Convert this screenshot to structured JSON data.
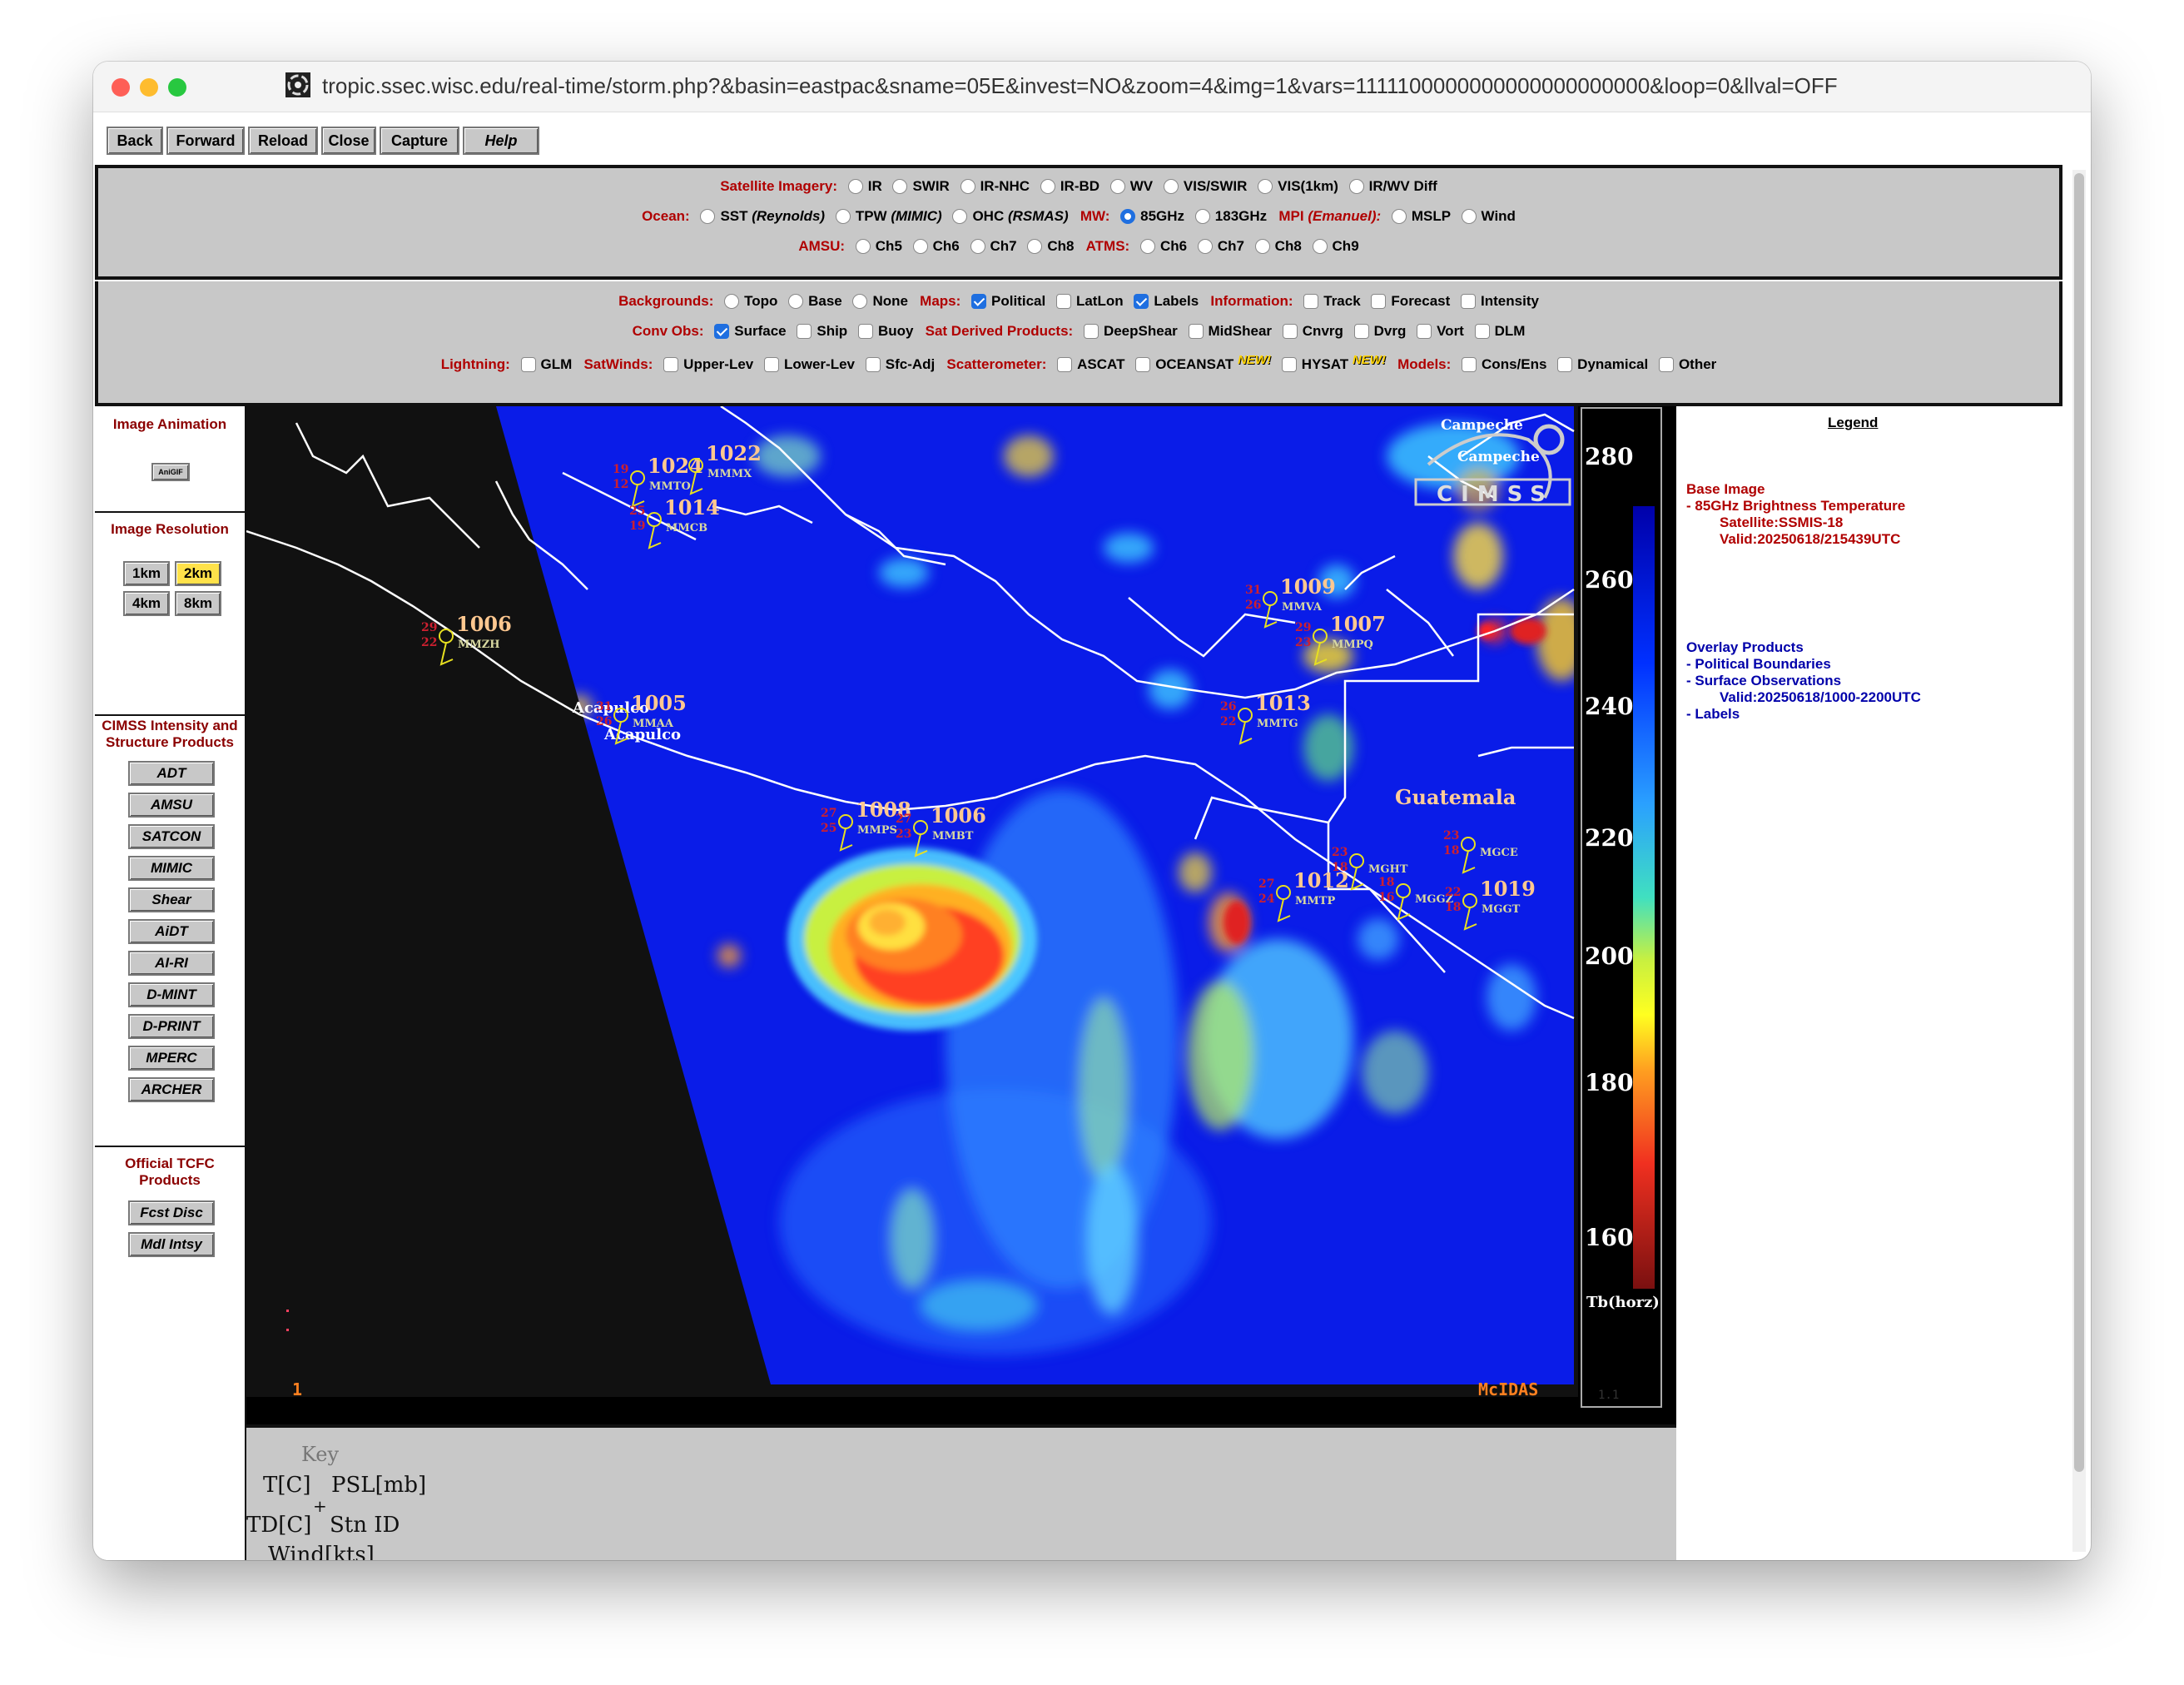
{
  "browser": {
    "url": "tropic.ssec.wisc.edu/real-time/storm.php?&basin=eastpac&sname=05E&invest=NO&zoom=4&img=1&vars=1111100000000000000000000&loop=0&llval=OFF",
    "nav_buttons": [
      "Back",
      "Forward",
      "Reload",
      "Close",
      "Capture",
      "Help"
    ]
  },
  "controls": {
    "satellite_imagery": {
      "label": "Satellite Imagery:",
      "options": [
        "IR",
        "SWIR",
        "IR-NHC",
        "IR-BD",
        "WV",
        "VIS/SWIR",
        "VIS(1km)",
        "IR/WV Diff"
      ]
    },
    "ocean": {
      "label": "Ocean:",
      "options": [
        "SST",
        "TPW",
        "OHC"
      ],
      "subs": [
        "(Reynolds)",
        "(MIMIC)",
        "(RSMAS)"
      ]
    },
    "mw": {
      "label": "MW:",
      "options": [
        "85GHz",
        "183GHz"
      ],
      "selected": "85GHz"
    },
    "mpi": {
      "label": "MPI",
      "sub": "(Emanuel):",
      "options": [
        "MSLP",
        "Wind"
      ]
    },
    "amsu": {
      "label": "AMSU:",
      "options": [
        "Ch5",
        "Ch6",
        "Ch7",
        "Ch8"
      ]
    },
    "atms": {
      "label": "ATMS:",
      "options": [
        "Ch6",
        "Ch7",
        "Ch8",
        "Ch9"
      ]
    },
    "backgrounds": {
      "label": "Backgrounds:",
      "options": [
        "Topo",
        "Base",
        "None"
      ]
    },
    "maps": {
      "label": "Maps:",
      "options": [
        "Political",
        "LatLon",
        "Labels"
      ],
      "checked": [
        "Political",
        "Labels"
      ]
    },
    "information": {
      "label": "Information:",
      "options": [
        "Track",
        "Forecast",
        "Intensity"
      ]
    },
    "conv_obs": {
      "label": "Conv Obs:",
      "options": [
        "Surface",
        "Ship",
        "Buoy"
      ],
      "checked": [
        "Surface"
      ]
    },
    "sat_derived": {
      "label": "Sat Derived Products:",
      "options": [
        "DeepShear",
        "MidShear",
        "Cnvrg",
        "Dvrg",
        "Vort",
        "DLM"
      ]
    },
    "lightning": {
      "label": "Lightning:",
      "options": [
        "GLM"
      ]
    },
    "satwinds": {
      "label": "SatWinds:",
      "options": [
        "Upper-Lev",
        "Lower-Lev",
        "Sfc-Adj"
      ]
    },
    "scatterometer": {
      "label": "Scatterometer:",
      "options": [
        "ASCAT",
        "OCEANSAT",
        "HYSAT"
      ],
      "new_badge": "NEW!"
    },
    "models": {
      "label": "Models:",
      "options": [
        "Cons/Ens",
        "Dynamical",
        "Other"
      ]
    }
  },
  "sidebar": {
    "animation_title": "Image Animation",
    "animgif": "AniGIF",
    "resolution_title": "Image Resolution",
    "resolutions": [
      "1km",
      "2km",
      "4km",
      "8km"
    ],
    "selected_resolution": "2km",
    "cimss_title": "CIMSS Intensity and Structure Products",
    "cimss_products": [
      "ADT",
      "AMSU",
      "SATCON",
      "MIMIC",
      "Shear",
      "AiDT",
      "AI-RI",
      "D-MINT",
      "D-PRINT",
      "MPERC",
      "ARCHER"
    ],
    "tcfc_title": "Official TCFC Products",
    "tcfc_products": [
      "Fcst Disc",
      "Mdl Intsy"
    ]
  },
  "map": {
    "colorbar_ticks": [
      "280",
      "260",
      "240",
      "220",
      "200",
      "180",
      "160"
    ],
    "colorbar_unit": "Tb(horz)",
    "frame_number": "1",
    "mcidas": "McIDAS",
    "version": "1.1",
    "cimss_logo": "CIMSS",
    "places": [
      "Campeche",
      "Campeche",
      "Acapulco",
      "Acapulco",
      "Guatemala"
    ],
    "stations": [
      {
        "psl": "1024",
        "id": "MMTO",
        "t": "19",
        "td": "12"
      },
      {
        "psl": "1022",
        "id": "MMMX",
        "t": "",
        "td": ""
      },
      {
        "psl": "1014",
        "id": "MMCB",
        "t": "25",
        "td": "19"
      },
      {
        "psl": "1006",
        "id": "MMZH",
        "t": "29",
        "td": "22"
      },
      {
        "psl": "1005",
        "id": "MMAA",
        "t": "31",
        "td": "26"
      },
      {
        "psl": "1009",
        "id": "MMVA",
        "t": "31",
        "td": "26"
      },
      {
        "psl": "1007",
        "id": "MMPQ",
        "t": "29",
        "td": "23"
      },
      {
        "psl": "1013",
        "id": "MMTG",
        "t": "26",
        "td": "22"
      },
      {
        "psl": "1008",
        "id": "MMPS",
        "t": "27",
        "td": "25"
      },
      {
        "psl": "1006",
        "id": "MMBT",
        "t": "27",
        "td": "23"
      },
      {
        "psl": "1012",
        "id": "MMTP",
        "t": "27",
        "td": "24"
      },
      {
        "psl": "",
        "id": "MGHT",
        "t": "23",
        "td": "18"
      },
      {
        "psl": "",
        "id": "MGGZ",
        "t": "18",
        "td": "16"
      },
      {
        "psl": "",
        "id": "MGCE",
        "t": "23",
        "td": "18"
      },
      {
        "psl": "1019",
        "id": "MGGT",
        "t": "22",
        "td": "18"
      }
    ]
  },
  "key": {
    "title": "Key",
    "t": "T[C]",
    "psl": "PSL[mb]",
    "plus": "+",
    "td": "TD[C]",
    "stn": "Stn ID",
    "wind": "Wind[kts]"
  },
  "legend": {
    "title": "Legend",
    "base_image": "Base Image",
    "base_lines": [
      "-  85GHz Brightness Temperature",
      "Satellite:SSMIS-18",
      "Valid:20250618/215439UTC"
    ],
    "overlay_title": "Overlay Products",
    "overlay_lines": [
      "-  Political Boundaries",
      "-  Surface Observations",
      "Valid:20250618/1000-2200UTC",
      "-  Labels"
    ]
  }
}
